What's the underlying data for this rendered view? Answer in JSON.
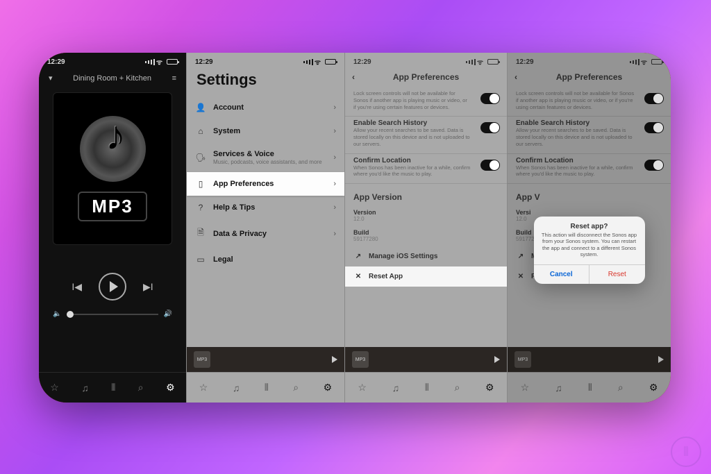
{
  "status": {
    "time": "12:29"
  },
  "pane1": {
    "room": "Dining Room + Kitchen",
    "album_label": "MP3"
  },
  "pane2": {
    "title": "Settings",
    "items": [
      {
        "icon": "👤",
        "label": "Account",
        "sub": ""
      },
      {
        "icon": "⌂",
        "label": "System",
        "sub": ""
      },
      {
        "icon": "🗣",
        "label": "Services & Voice",
        "sub": "Music, podcasts, voice assistants, and more"
      },
      {
        "icon": "▯",
        "label": "App Preferences",
        "sub": ""
      },
      {
        "icon": "?",
        "label": "Help & Tips",
        "sub": ""
      },
      {
        "icon": "🗎",
        "label": "Data & Privacy",
        "sub": ""
      },
      {
        "icon": "▭",
        "label": "Legal",
        "sub": ""
      }
    ]
  },
  "prefs": {
    "title": "App Preferences",
    "lock_desc": "Lock screen controls will not be available for Sonos if another app is playing music or video, or if you're using certain features or devices.",
    "search_title": "Enable Search History",
    "search_desc": "Allow your recent searches to be saved. Data is stored locally on this device and is not uploaded to our servers.",
    "loc_title": "Confirm Location",
    "loc_desc": "When Sonos has been inactive for a while, confirm where you'd like the music to play.",
    "section": "App Version",
    "version_k": "Version",
    "version_v": "12.0",
    "build_k": "Build",
    "build_v": "59177280",
    "manage": "Manage iOS Settings",
    "reset": "Reset App"
  },
  "pane4_section_trunc": "App V",
  "pane4_version_trunc": "Versi",
  "dialog": {
    "title": "Reset app?",
    "msg": "This action will disconnect the Sonos app from your Sonos system. You can restart the app and connect to a different Sonos system.",
    "cancel": "Cancel",
    "reset": "Reset"
  },
  "mini_thumb": "MP3"
}
